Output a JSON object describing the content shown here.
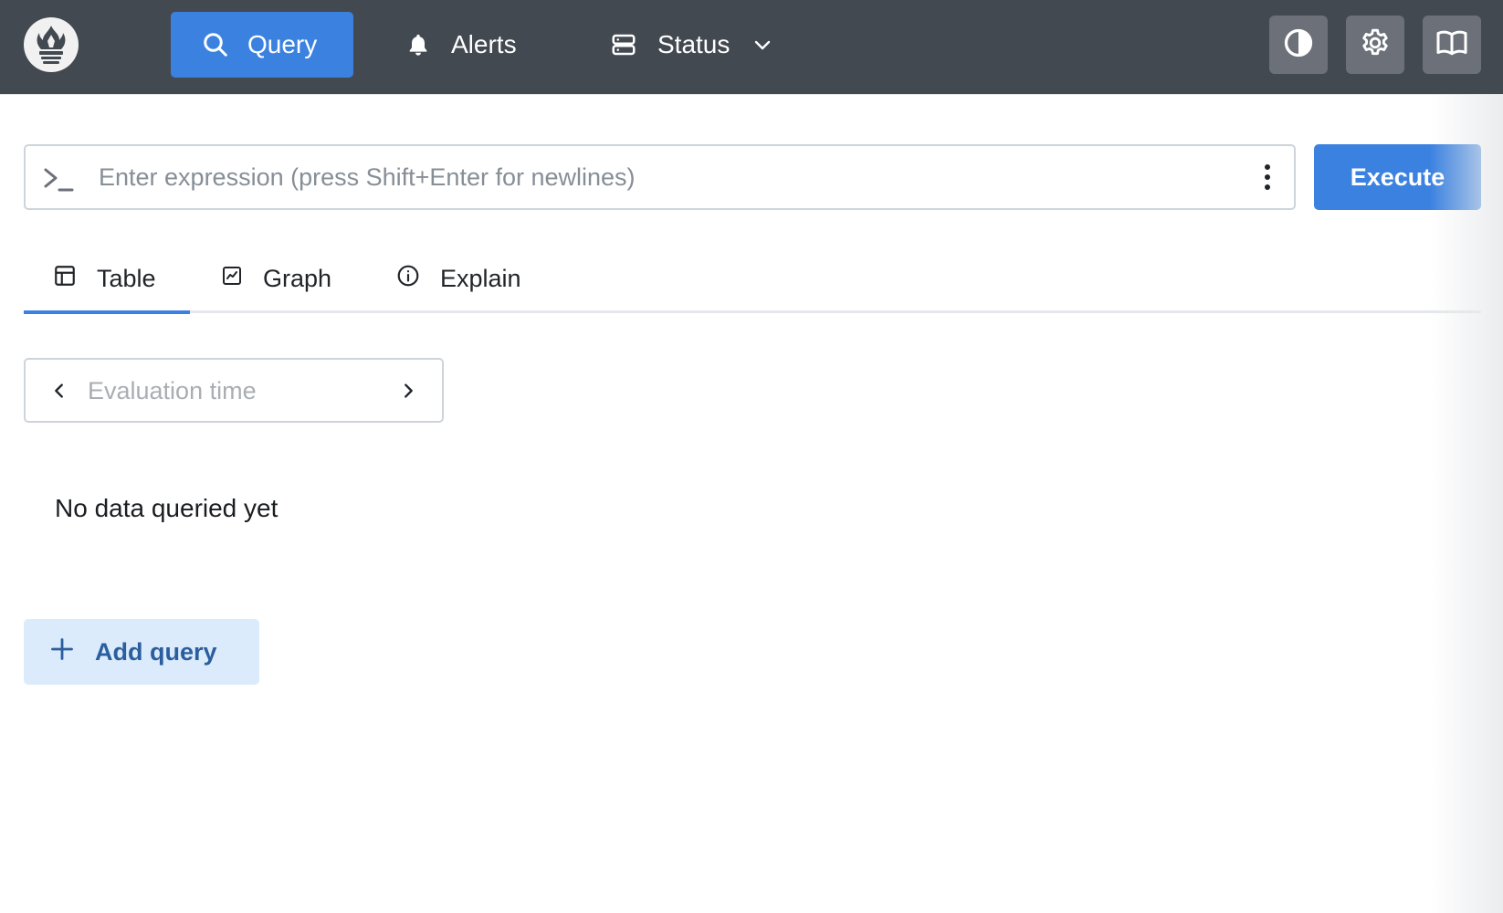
{
  "navbar": {
    "logo_icon": "prometheus-flame-icon",
    "items": [
      {
        "label": "Query",
        "icon": "search-icon",
        "active": true
      },
      {
        "label": "Alerts",
        "icon": "bell-icon",
        "active": false
      },
      {
        "label": "Status",
        "icon": "server-icon",
        "active": false,
        "has_dropdown": true
      }
    ],
    "tools": [
      {
        "icon": "contrast-icon"
      },
      {
        "icon": "gear-icon"
      },
      {
        "icon": "book-icon"
      }
    ],
    "colors": {
      "background": "#434951",
      "accent": "#3b82e0"
    }
  },
  "query": {
    "expression_placeholder": "Enter expression (press Shift+Enter for newlines)",
    "expression_value": "",
    "execute_label": "Execute"
  },
  "tabs": [
    {
      "label": "Table",
      "icon": "table-icon",
      "active": true
    },
    {
      "label": "Graph",
      "icon": "chart-icon",
      "active": false
    },
    {
      "label": "Explain",
      "icon": "info-icon",
      "active": false
    }
  ],
  "evaluation": {
    "placeholder": "Evaluation time",
    "value": ""
  },
  "results": {
    "empty_message": "No data queried yet"
  },
  "actions": {
    "add_query_label": "Add query"
  }
}
